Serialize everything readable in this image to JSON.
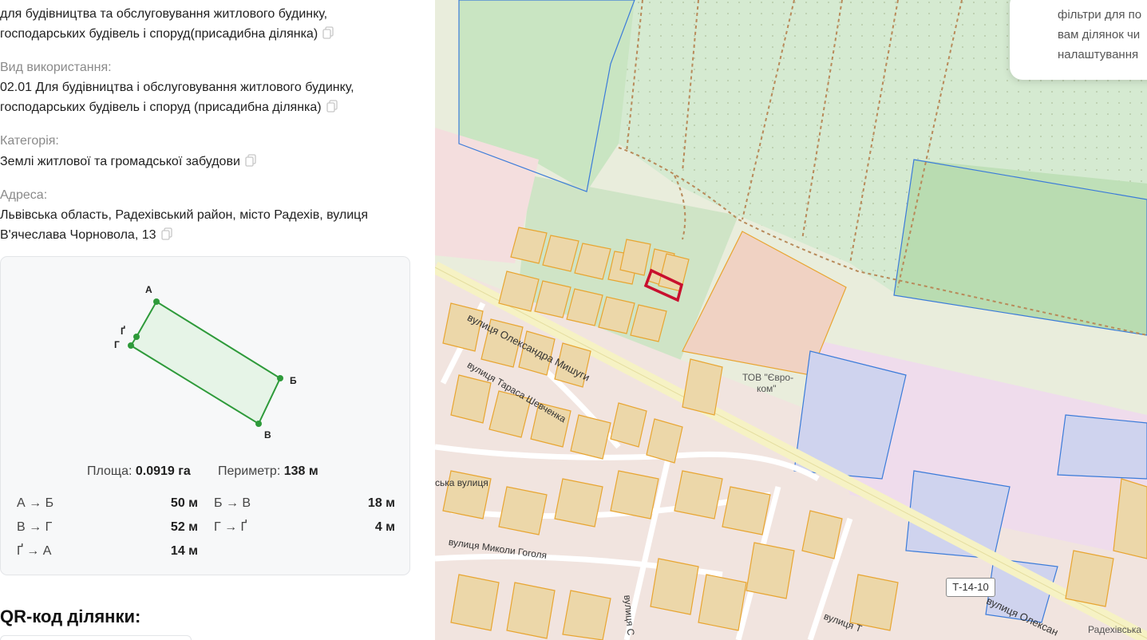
{
  "info": {
    "purpose_cont_line1": "для будівництва та обслуговування житлового будинку,",
    "purpose_cont_line2": "господарських будівель і споруд(присадибна ділянка)",
    "usage_label": "Вид використання:",
    "usage_line1": "02.01 Для будівництва і обслуговування житлового будинку,",
    "usage_line2": "господарських будівель і споруд (присадибна ділянка)",
    "category_label": "Категорія:",
    "category_value": "Землі житлової та громадської забудови",
    "address_label": "Адреса:",
    "address_line1": "Львівська область, Радехівський район, місто Радехів, вулиця",
    "address_line2": "В'ячеслава Чорновола, 13"
  },
  "parcel": {
    "vertices": {
      "a": "А",
      "b": "Б",
      "v": "В",
      "g": "Г",
      "g2": "Ґ"
    },
    "area_label": "Площа:",
    "area_value": "0.0919 га",
    "perimeter_label": "Периметр:",
    "perimeter_value": "138 м",
    "segments": [
      {
        "name": "А → Б",
        "value": "50 м"
      },
      {
        "name": "Б → В",
        "value": "18 м"
      },
      {
        "name": "В → Г",
        "value": "52 м"
      },
      {
        "name": "Г → Ґ",
        "value": "4 м"
      },
      {
        "name": "Ґ → А",
        "value": "14 м"
      }
    ],
    "colors": {
      "outline": "#2e9a3a",
      "fill": "#e6f4e7"
    }
  },
  "qr_title": "QR-код ділянки:",
  "map": {
    "popup_line1": "фільтри для по",
    "popup_line2": "вам ділянок чи",
    "popup_line3": "налаштування",
    "street1": "вулиця Олександра Мишуги",
    "street2": "вулиця Тараса Шевченка",
    "street3": "вулиця Миколи Гоголя",
    "street4": "ська вулиця",
    "street5": "вулиця С",
    "street6": "вулиця Олексан",
    "street7": "вулиця Т",
    "company_line1": "ТОВ \"Євро-",
    "company_line2": "ком\"",
    "road_code": "Т-14-10",
    "place_name": "Радехівська",
    "colors": {
      "selected_parcel": "#c8102e",
      "parcel_outline": "#e8a531",
      "state_outline": "#3b7bd9"
    }
  }
}
